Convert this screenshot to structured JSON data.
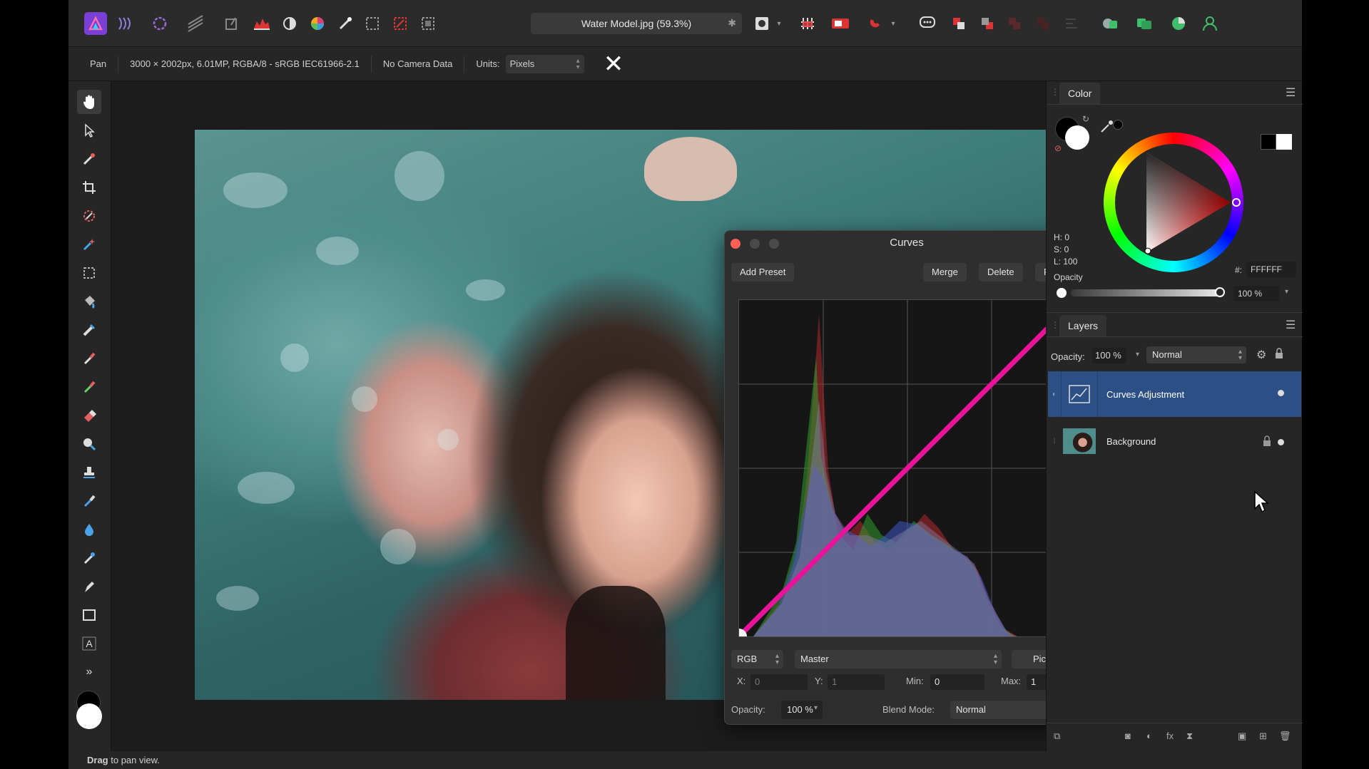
{
  "toolbar": {
    "document_tab": "Water Model.jpg (59.3%)"
  },
  "context": {
    "tool_name": "Pan",
    "doc_info": "3000 × 2002px, 6.01MP, RGBA/8 - sRGB IEC61966-2.1",
    "camera": "No Camera Data",
    "units_label": "Units:",
    "units_value": "Pixels"
  },
  "curves_dialog": {
    "title": "Curves",
    "add_preset": "Add Preset",
    "merge": "Merge",
    "delete": "Delete",
    "reset": "Reset",
    "color_space": "RGB",
    "channel": "Master",
    "picker": "Picker",
    "x_label": "X:",
    "x_value": "0",
    "y_label": "Y:",
    "y_value": "1",
    "min_label": "Min:",
    "min_value": "0",
    "max_label": "Max:",
    "max_value": "1",
    "opacity_label": "Opacity:",
    "opacity_value": "100 %",
    "blend_label": "Blend Mode:",
    "blend_value": "Normal",
    "curve_color": "#e8139b"
  },
  "color_panel": {
    "tab": "Color",
    "h": "H: 0",
    "s": "S: 0",
    "l": "L: 100",
    "hex_label": "#:",
    "hex_value": "FFFFFF",
    "opacity_label": "Opacity",
    "opacity_value": "100 %"
  },
  "layers_panel": {
    "tab": "Layers",
    "opacity_label": "Opacity:",
    "opacity_value": "100 %",
    "blend_value": "Normal",
    "layers": [
      {
        "name": "Curves Adjustment",
        "selected": true
      },
      {
        "name": "Background",
        "selected": false
      }
    ]
  },
  "status": {
    "bold": "Drag",
    "text": " to pan view."
  }
}
